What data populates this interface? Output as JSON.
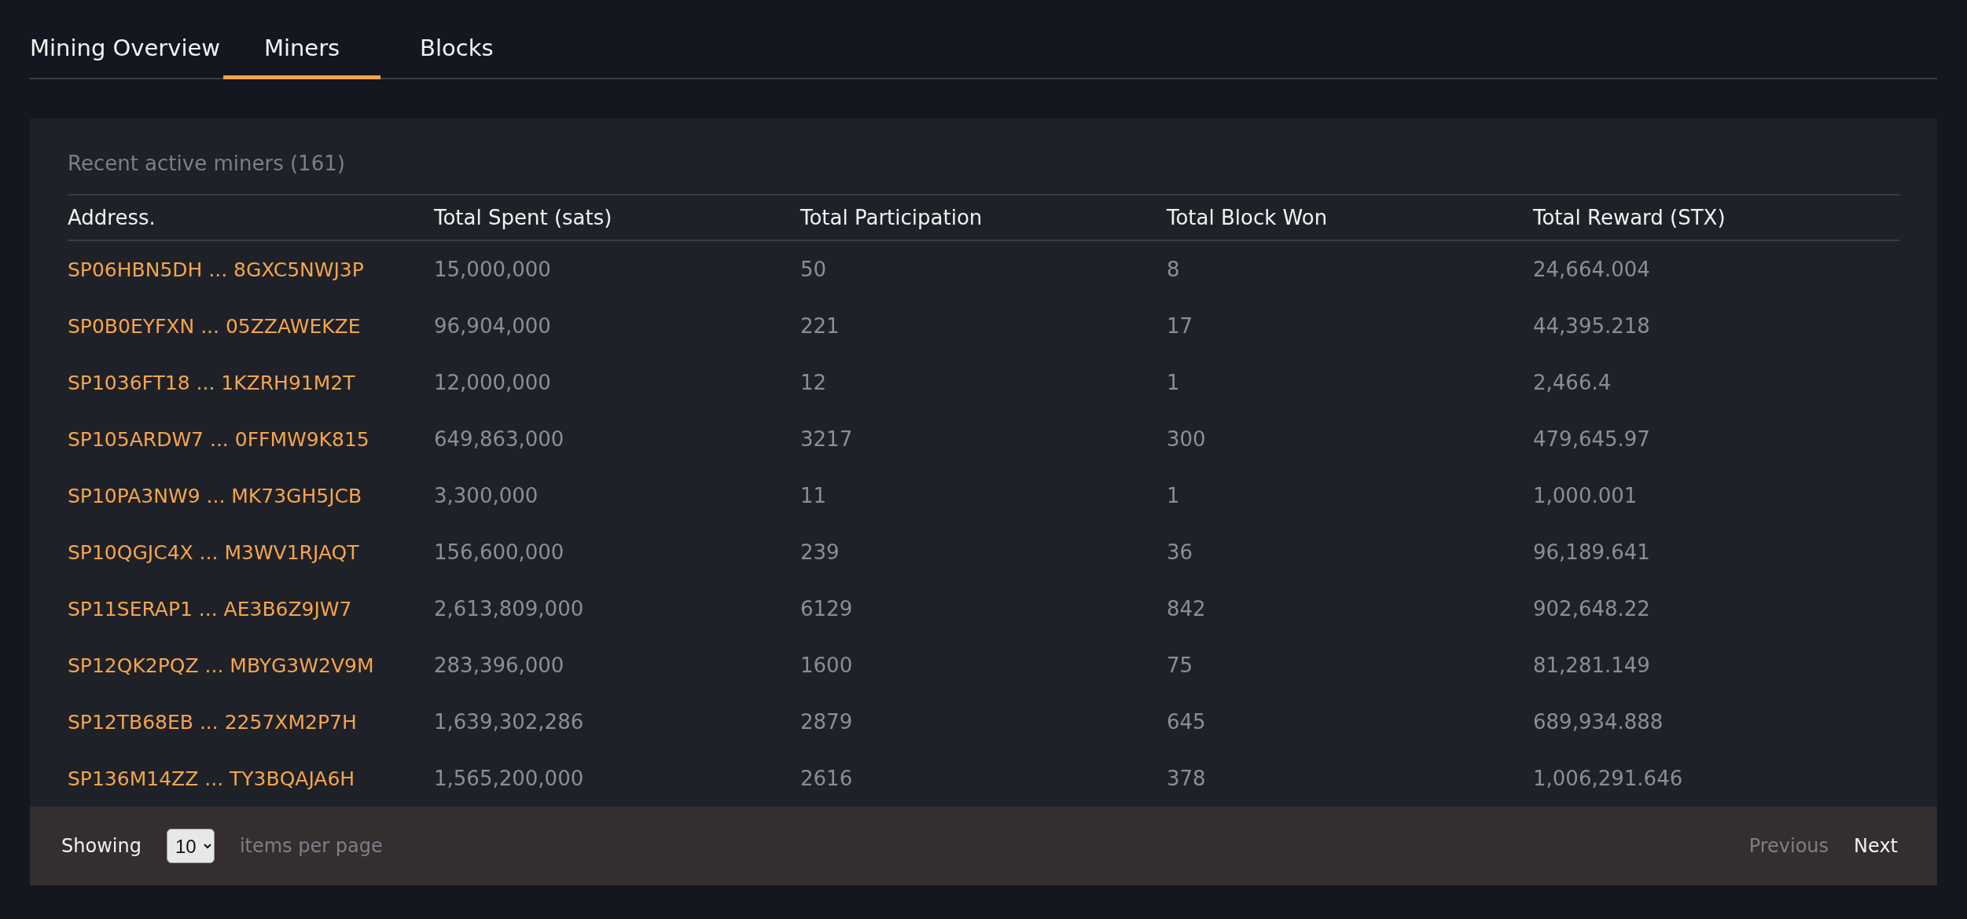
{
  "tabs": [
    {
      "label": "Mining Overview",
      "selected": false
    },
    {
      "label": "Miners",
      "selected": true
    },
    {
      "label": "Blocks",
      "selected": false
    }
  ],
  "table": {
    "title": "Recent active miners (161)",
    "columns": [
      "Address.",
      "Total Spent (sats)",
      "Total Participation",
      "Total Block Won",
      "Total Reward (STX)"
    ],
    "rows": [
      {
        "address": "SP06HBN5DH ... 8GXC5NWJ3P",
        "spent": "15,000,000",
        "participation": "50",
        "won": "8",
        "reward": "24,664.004"
      },
      {
        "address": "SP0B0EYFXN ... 05ZZAWEKZE",
        "spent": "96,904,000",
        "participation": "221",
        "won": "17",
        "reward": "44,395.218"
      },
      {
        "address": "SP1036FT18 ... 1KZRH91M2T",
        "spent": "12,000,000",
        "participation": "12",
        "won": "1",
        "reward": "2,466.4"
      },
      {
        "address": "SP105ARDW7 ... 0FFMW9K815",
        "spent": "649,863,000",
        "participation": "3217",
        "won": "300",
        "reward": "479,645.97"
      },
      {
        "address": "SP10PA3NW9 ... MK73GH5JCB",
        "spent": "3,300,000",
        "participation": "11",
        "won": "1",
        "reward": "1,000.001"
      },
      {
        "address": "SP10QGJC4X ... M3WV1RJAQT",
        "spent": "156,600,000",
        "participation": "239",
        "won": "36",
        "reward": "96,189.641"
      },
      {
        "address": "SP11SERAP1 ... AE3B6Z9JW7",
        "spent": "2,613,809,000",
        "participation": "6129",
        "won": "842",
        "reward": "902,648.22"
      },
      {
        "address": "SP12QK2PQZ ... MBYG3W2V9M",
        "spent": "283,396,000",
        "participation": "1600",
        "won": "75",
        "reward": "81,281.149"
      },
      {
        "address": "SP12TB68EB ... 2257XM2P7H",
        "spent": "1,639,302,286",
        "participation": "2879",
        "won": "645",
        "reward": "689,934.888"
      },
      {
        "address": "SP136M14ZZ ... TY3BQAJA6H",
        "spent": "1,565,200,000",
        "participation": "2616",
        "won": "378",
        "reward": "1,006,291.646"
      }
    ]
  },
  "pager": {
    "showing_label": "Showing",
    "page_size": "10",
    "per_page_label": "items per page",
    "previous": {
      "label": "Previous",
      "disabled": true
    },
    "next": {
      "label": "Next",
      "disabled": false
    }
  }
}
